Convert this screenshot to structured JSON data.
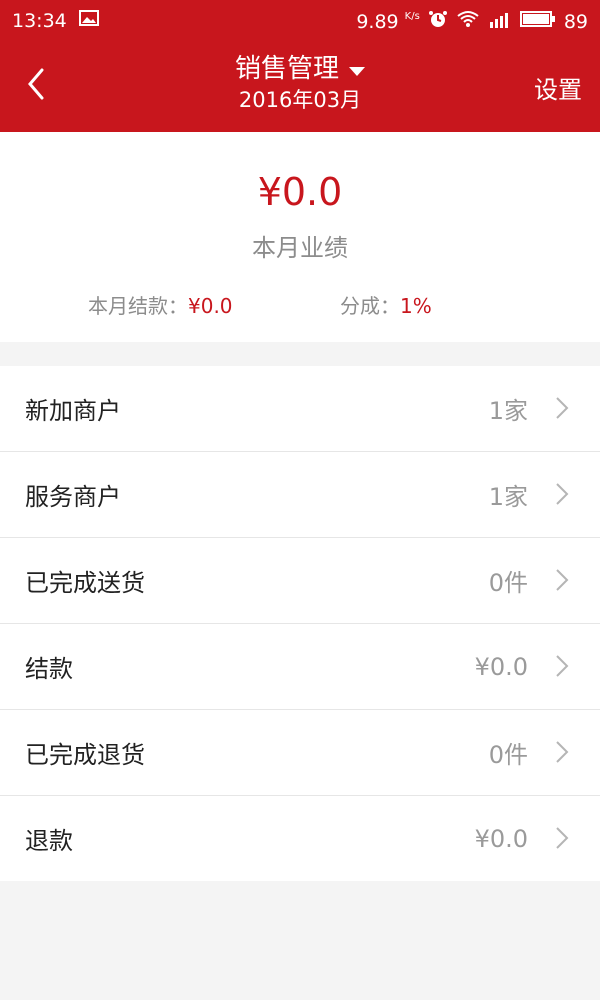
{
  "status_bar": {
    "time": "13:34",
    "speed": "9.89",
    "speed_unit": "K/s",
    "battery": "89",
    "icons": [
      "image-icon",
      "alarm-icon",
      "wifi-icon",
      "signal-icon",
      "battery-icon"
    ]
  },
  "header": {
    "back_icon": "chevron-left-icon",
    "title": "销售管理",
    "dropdown_icon": "triangle-down-icon",
    "subtitle": "2016年03月",
    "settings_label": "设置"
  },
  "summary": {
    "total_amount": "¥0.0",
    "total_label": "本月业绩",
    "settlement_label": "本月结款：",
    "settlement_value": "¥0.0",
    "commission_label": "分成：",
    "commission_value": "1%"
  },
  "list": [
    {
      "label": "新加商户",
      "value": "1家"
    },
    {
      "label": "服务商户",
      "value": "1家"
    },
    {
      "label": "已完成送货",
      "value": "0件"
    },
    {
      "label": "结款",
      "value": "¥0.0"
    },
    {
      "label": "已完成退货",
      "value": "0件"
    },
    {
      "label": "退款",
      "value": "¥0.0"
    }
  ],
  "colors": {
    "accent": "#c8161d",
    "muted": "#8c8c8c",
    "background": "#f4f4f4"
  }
}
